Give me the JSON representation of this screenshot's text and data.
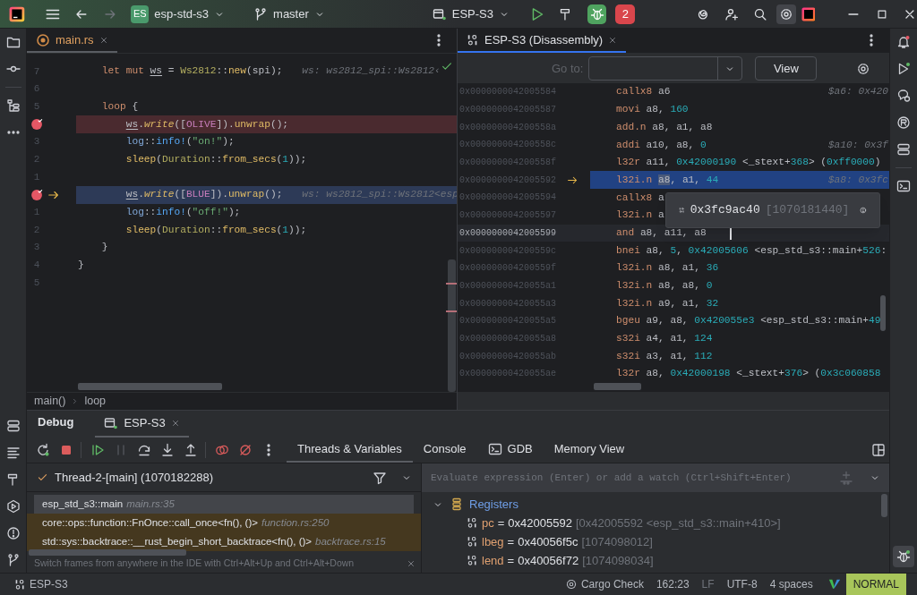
{
  "title_bar": {
    "project_badge": "ES",
    "project": "esp-std-s3",
    "branch": "master",
    "run_configuration": "ESP-S3",
    "debug_sessions": "2"
  },
  "editor": {
    "tab": {
      "label": "main.rs",
      "selected": true,
      "focused": false
    },
    "lines": [
      {
        "number": "7",
        "breakpoint": false,
        "execution_point": false,
        "tokens": [
          {
            "text": "    let mut",
            "kind": "keyword"
          },
          {
            "text": " ws",
            "kind": "variable"
          },
          {
            "text": " = ",
            "kind": "plain"
          },
          {
            "text": "Ws2812",
            "kind": "type"
          },
          {
            "text": "::",
            "kind": "plain"
          },
          {
            "text": "new",
            "kind": "function"
          },
          {
            "text": "(spi);",
            "kind": "plain"
          }
        ],
        "hint": "ws: ws2812_spi::Ws2812‹"
      },
      {
        "number": "6",
        "breakpoint": false,
        "execution_point": false
      },
      {
        "number": "5",
        "breakpoint": false,
        "execution_point": false,
        "tokens": [
          {
            "text": "    loop",
            "kind": "keyword"
          },
          {
            "text": " {",
            "kind": "plain"
          }
        ]
      },
      {
        "breakpoint": true,
        "execution_point": false,
        "tokens": [
          {
            "text": "        ws",
            "kind": "variable"
          },
          {
            "text": ".",
            "kind": "plain"
          },
          {
            "text": "write",
            "kind": "method"
          },
          {
            "text": "([",
            "kind": "plain"
          },
          {
            "text": "OLIVE",
            "kind": "constant"
          },
          {
            "text": "]).",
            "kind": "plain"
          },
          {
            "text": "unwrap",
            "kind": "function"
          },
          {
            "text": "();",
            "kind": "plain"
          }
        ]
      },
      {
        "number": "3",
        "breakpoint": false,
        "execution_point": false,
        "tokens": [
          {
            "text": "        log",
            "kind": "module"
          },
          {
            "text": "::",
            "kind": "plain"
          },
          {
            "text": "info!",
            "kind": "macro"
          },
          {
            "text": "(",
            "kind": "plain"
          },
          {
            "text": "\"on!\"",
            "kind": "string"
          },
          {
            "text": ");",
            "kind": "plain"
          }
        ]
      },
      {
        "number": "2",
        "breakpoint": false,
        "execution_point": false,
        "tokens": [
          {
            "text": "        sleep",
            "kind": "function"
          },
          {
            "text": "(",
            "kind": "plain"
          },
          {
            "text": "Duration",
            "kind": "type"
          },
          {
            "text": "::",
            "kind": "plain"
          },
          {
            "text": "from_secs",
            "kind": "function"
          },
          {
            "text": "(",
            "kind": "plain"
          },
          {
            "text": "1",
            "kind": "number"
          },
          {
            "text": "));",
            "kind": "plain"
          }
        ]
      },
      {
        "number": "1",
        "breakpoint": false,
        "execution_point": false
      },
      {
        "breakpoint": true,
        "execution_point": true,
        "tokens": [
          {
            "text": "        ws",
            "kind": "variable"
          },
          {
            "text": ".",
            "kind": "plain"
          },
          {
            "text": "write",
            "kind": "method"
          },
          {
            "text": "([",
            "kind": "plain"
          },
          {
            "text": "BLUE",
            "kind": "constant"
          },
          {
            "text": "]).",
            "kind": "plain"
          },
          {
            "text": "unwrap",
            "kind": "function"
          },
          {
            "text": "();",
            "kind": "plain"
          }
        ],
        "hint": "ws: ws2812_spi::Ws2812<esp"
      },
      {
        "number": "1",
        "breakpoint": false,
        "execution_point": false,
        "tokens": [
          {
            "text": "        log",
            "kind": "module"
          },
          {
            "text": "::",
            "kind": "plain"
          },
          {
            "text": "info!",
            "kind": "macro"
          },
          {
            "text": "(",
            "kind": "plain"
          },
          {
            "text": "\"off!\"",
            "kind": "string"
          },
          {
            "text": ");",
            "kind": "plain"
          }
        ]
      },
      {
        "number": "2",
        "breakpoint": false,
        "execution_point": false,
        "tokens": [
          {
            "text": "        sleep",
            "kind": "function"
          },
          {
            "text": "(",
            "kind": "plain"
          },
          {
            "text": "Duration",
            "kind": "type"
          },
          {
            "text": "::",
            "kind": "plain"
          },
          {
            "text": "from_secs",
            "kind": "function"
          },
          {
            "text": "(",
            "kind": "plain"
          },
          {
            "text": "1",
            "kind": "number"
          },
          {
            "text": "));",
            "kind": "plain"
          }
        ]
      },
      {
        "number": "3",
        "breakpoint": false,
        "execution_point": false,
        "tokens": [
          {
            "text": "    }",
            "kind": "plain"
          }
        ]
      },
      {
        "number": "4",
        "breakpoint": false,
        "execution_point": false,
        "tokens": [
          {
            "text": "}",
            "kind": "plain"
          }
        ]
      },
      {
        "number": "5",
        "breakpoint": false,
        "execution_point": false
      }
    ],
    "breadcrumbs": [
      "main()",
      "loop"
    ]
  },
  "disassembly": {
    "tab": {
      "label": "ESP-S3 (Disassembly)",
      "selected": true,
      "focused": true
    },
    "goto_label": "Go to:",
    "view_button": "View",
    "rows": [
      {
        "address": "0x0000000042005584",
        "selected": false,
        "execution_point": false,
        "caret_line": false,
        "tokens": [
          {
            "text": "callx8",
            "kind": "mnemonic"
          },
          {
            "text": " a6",
            "kind": "plain"
          }
        ],
        "hint": "$a6: 0x420"
      },
      {
        "address": "0x0000000042005587",
        "selected": false,
        "execution_point": false,
        "caret_line": false,
        "tokens": [
          {
            "text": "movi",
            "kind": "mnemonic"
          },
          {
            "text": " a8, ",
            "kind": "plain"
          },
          {
            "text": "160",
            "kind": "number"
          }
        ]
      },
      {
        "address": "0x000000004200558a",
        "selected": false,
        "execution_point": false,
        "caret_line": false,
        "tokens": [
          {
            "text": "add.n",
            "kind": "mnemonic"
          },
          {
            "text": " a8, a1, a8",
            "kind": "plain"
          }
        ]
      },
      {
        "address": "0x000000004200558c",
        "selected": false,
        "execution_point": false,
        "caret_line": false,
        "tokens": [
          {
            "text": "addi",
            "kind": "mnemonic"
          },
          {
            "text": " a10, a8, ",
            "kind": "plain"
          },
          {
            "text": "0",
            "kind": "number"
          }
        ],
        "hint": "$a10: 0x3f"
      },
      {
        "address": "0x000000004200558f",
        "selected": false,
        "execution_point": false,
        "caret_line": false,
        "tokens": [
          {
            "text": "l32r",
            "kind": "mnemonic"
          },
          {
            "text": " a11, ",
            "kind": "plain"
          },
          {
            "text": "0x42000190",
            "kind": "number"
          },
          {
            "text": " <_stext+",
            "kind": "plain"
          },
          {
            "text": "368",
            "kind": "number"
          },
          {
            "text": "> (",
            "kind": "plain"
          },
          {
            "text": "0xff0000",
            "kind": "number"
          },
          {
            "text": ")",
            "kind": "plain"
          }
        ]
      },
      {
        "address": "0x0000000042005592",
        "selected": true,
        "execution_point": true,
        "caret_line": false,
        "tokens": [
          {
            "text": "l32i.n",
            "kind": "mnemonic"
          },
          {
            "text": " a8",
            "kind": "match"
          },
          {
            "text": ", a1, ",
            "kind": "plain"
          },
          {
            "text": "44",
            "kind": "number"
          }
        ],
        "hint": "$a8: 0x3fc"
      },
      {
        "address": "0x0000000042005594",
        "selected": false,
        "execution_point": false,
        "caret_line": false,
        "tokens": [
          {
            "text": "callx8",
            "kind": "mnemonic"
          },
          {
            "text": " a",
            "kind": "plain"
          }
        ]
      },
      {
        "address": "0x0000000042005597",
        "selected": false,
        "execution_point": false,
        "caret_line": false,
        "tokens": [
          {
            "text": "l32i.n",
            "kind": "mnemonic"
          },
          {
            "text": " a",
            "kind": "plain"
          }
        ]
      },
      {
        "address": "0x0000000042005599",
        "selected": false,
        "execution_point": false,
        "caret_line": true,
        "tokens": [
          {
            "text": "and",
            "kind": "mnemonic"
          },
          {
            "text": " a8, a11, a8",
            "kind": "plain"
          }
        ]
      },
      {
        "address": "0x000000004200559c",
        "selected": false,
        "execution_point": false,
        "caret_line": false,
        "tokens": [
          {
            "text": "bnei",
            "kind": "mnemonic"
          },
          {
            "text": " a8, ",
            "kind": "plain"
          },
          {
            "text": "5",
            "kind": "number"
          },
          {
            "text": ", ",
            "kind": "plain"
          },
          {
            "text": "0x42005606",
            "kind": "number"
          },
          {
            "text": " <esp_std_s3::main+",
            "kind": "plain"
          },
          {
            "text": "526",
            "kind": "number"
          },
          {
            "text": ":",
            "kind": "plain"
          }
        ]
      },
      {
        "address": "0x000000004200559f",
        "selected": false,
        "execution_point": false,
        "caret_line": false,
        "tokens": [
          {
            "text": "l32i.n",
            "kind": "mnemonic"
          },
          {
            "text": " a8, a1, ",
            "kind": "plain"
          },
          {
            "text": "36",
            "kind": "number"
          }
        ]
      },
      {
        "address": "0x00000000420055a1",
        "selected": false,
        "execution_point": false,
        "caret_line": false,
        "tokens": [
          {
            "text": "l32i.n",
            "kind": "mnemonic"
          },
          {
            "text": " a8, a8, ",
            "kind": "plain"
          },
          {
            "text": "0",
            "kind": "number"
          }
        ]
      },
      {
        "address": "0x00000000420055a3",
        "selected": false,
        "execution_point": false,
        "caret_line": false,
        "tokens": [
          {
            "text": "l32i.n",
            "kind": "mnemonic"
          },
          {
            "text": " a9, a1, ",
            "kind": "plain"
          },
          {
            "text": "32",
            "kind": "number"
          }
        ]
      },
      {
        "address": "0x00000000420055a5",
        "selected": false,
        "execution_point": false,
        "caret_line": false,
        "tokens": [
          {
            "text": "bgeu",
            "kind": "mnemonic"
          },
          {
            "text": " a9, a8, ",
            "kind": "plain"
          },
          {
            "text": "0x420055e3",
            "kind": "number"
          },
          {
            "text": " <esp_std_s3::main+",
            "kind": "plain"
          },
          {
            "text": "49",
            "kind": "number"
          }
        ]
      },
      {
        "address": "0x00000000420055a8",
        "selected": false,
        "execution_point": false,
        "caret_line": false,
        "tokens": [
          {
            "text": "s32i",
            "kind": "mnemonic"
          },
          {
            "text": " a4, a1, ",
            "kind": "plain"
          },
          {
            "text": "124",
            "kind": "number"
          }
        ]
      },
      {
        "address": "0x00000000420055ab",
        "selected": false,
        "execution_point": false,
        "caret_line": false,
        "tokens": [
          {
            "text": "s32i",
            "kind": "mnemonic"
          },
          {
            "text": " a3, a1, ",
            "kind": "plain"
          },
          {
            "text": "112",
            "kind": "number"
          }
        ]
      },
      {
        "address": "0x00000000420055ae",
        "selected": false,
        "execution_point": false,
        "caret_line": false,
        "tokens": [
          {
            "text": "l32r",
            "kind": "mnemonic"
          },
          {
            "text": " a8, ",
            "kind": "plain"
          },
          {
            "text": "0x42000198",
            "kind": "number"
          },
          {
            "text": " <_stext+",
            "kind": "plain"
          },
          {
            "text": "376",
            "kind": "number"
          },
          {
            "text": "> (",
            "kind": "plain"
          },
          {
            "text": "0x3c060858",
            "kind": "number"
          }
        ]
      }
    ],
    "popup": {
      "value": "0x3fc9ac40",
      "decimal": "[1070181440]"
    }
  },
  "debug": {
    "title": "Debug",
    "session_tab": {
      "label": "ESP-S3",
      "selected": true
    },
    "toolbar": [
      {
        "kind": "rerun",
        "disabled": false
      },
      {
        "kind": "stop",
        "disabled": false
      },
      {
        "kind": "resume",
        "disabled": false
      },
      {
        "kind": "pause",
        "disabled": true
      },
      {
        "kind": "step_over",
        "disabled": false
      },
      {
        "kind": "step_into",
        "disabled": false
      },
      {
        "kind": "step_out",
        "disabled": false
      },
      {
        "kind": "breakpoints",
        "disabled": false
      },
      {
        "kind": "mute_breakpoints",
        "disabled": false
      },
      {
        "kind": "more",
        "disabled": false
      }
    ],
    "tabs": [
      {
        "label": "Threads & Variables",
        "kind": "plain",
        "selected": true
      },
      {
        "label": "Console",
        "kind": "plain",
        "selected": false
      },
      {
        "label": "GDB",
        "kind": "terminal",
        "selected": false
      },
      {
        "label": "Memory View",
        "kind": "plain",
        "selected": false
      }
    ],
    "thread": "Thread-2-[main] (1070182288)",
    "frames": [
      {
        "function": "esp_std_s3::main",
        "location": "main.rs:35",
        "selected": true,
        "library": false
      },
      {
        "function": "core::ops::function::FnOnce::call_once<fn(), ()>",
        "location": "function.rs:250",
        "selected": false,
        "library": true
      },
      {
        "function": "std::sys::backtrace::__rust_begin_short_backtrace<fn(), ()>",
        "location": "backtrace.rs:15",
        "selected": false,
        "library": true
      }
    ],
    "hint": "Switch frames from anywhere in the IDE with Ctrl+Alt+Up and Ctrl+Alt+Down",
    "evaluate": {
      "placeholder": "Evaluate expression (Enter) or add a watch (Ctrl+Shift+Enter)"
    },
    "variables": [
      {
        "name": "Registers",
        "expanded": true,
        "children": [
          {
            "name": "pc",
            "operator": "=",
            "value": "0x42005592",
            "detail": "[0x42005592 <esp_std_s3::main+410>]"
          },
          {
            "name": "lbeg",
            "operator": "=",
            "value": "0x40056f5c",
            "detail": "[1074098012]"
          },
          {
            "name": "lend",
            "operator": "=",
            "value": "0x40056f72",
            "detail": "[1074098034]"
          }
        ]
      }
    ]
  },
  "status_bar": {
    "session": "ESP-S3",
    "items": [
      {
        "text": "Cargo Check",
        "kind": "gear"
      },
      {
        "text": "162:23",
        "kind": "plain"
      },
      {
        "text": "LF",
        "kind": "dim"
      },
      {
        "text": "UTF-8",
        "kind": "plain"
      },
      {
        "text": "4 spaces",
        "kind": "plain"
      }
    ],
    "mode": "NORMAL"
  }
}
